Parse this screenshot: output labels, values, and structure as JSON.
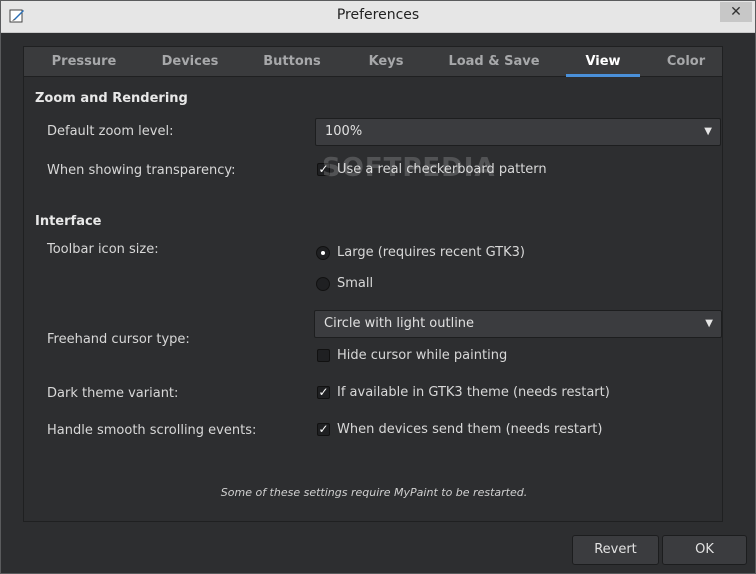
{
  "window": {
    "title": "Preferences",
    "close_label": "✕"
  },
  "tabs": [
    {
      "label": "Pressure",
      "active": false
    },
    {
      "label": "Devices",
      "active": false
    },
    {
      "label": "Buttons",
      "active": false
    },
    {
      "label": "Keys",
      "active": false
    },
    {
      "label": "Load & Save",
      "active": false
    },
    {
      "label": "View",
      "active": true
    },
    {
      "label": "Color",
      "active": false
    }
  ],
  "zoom_section": {
    "title": "Zoom and Rendering",
    "default_zoom_label": "Default zoom level:",
    "default_zoom_value": "100%",
    "transparency_label": "When showing transparency:",
    "checkerboard_text": "Use a real checkerboard pattern",
    "checkerboard_checked": true
  },
  "interface_section": {
    "title": "Interface",
    "toolbar_icon_label": "Toolbar icon size:",
    "icon_options": [
      {
        "label": "Large (requires recent GTK3)",
        "selected": true
      },
      {
        "label": "Small",
        "selected": false
      }
    ],
    "cursor_label": "Freehand cursor type:",
    "cursor_value": "Circle with light outline",
    "hide_cursor_text": "Hide cursor while painting",
    "hide_cursor_checked": false,
    "dark_theme_label": "Dark theme variant:",
    "dark_theme_text": "If available in GTK3 theme (needs restart)",
    "dark_theme_checked": true,
    "scroll_label": "Handle smooth scrolling events:",
    "scroll_text": "When devices send them (needs restart)",
    "scroll_checked": true
  },
  "note": "Some of these settings require MyPaint to be restarted.",
  "watermark": "SOFTPEDIA",
  "buttons": {
    "revert": "Revert",
    "ok": "OK"
  },
  "colors": {
    "accent": "#4a90d9",
    "background": "#2d2e30"
  }
}
